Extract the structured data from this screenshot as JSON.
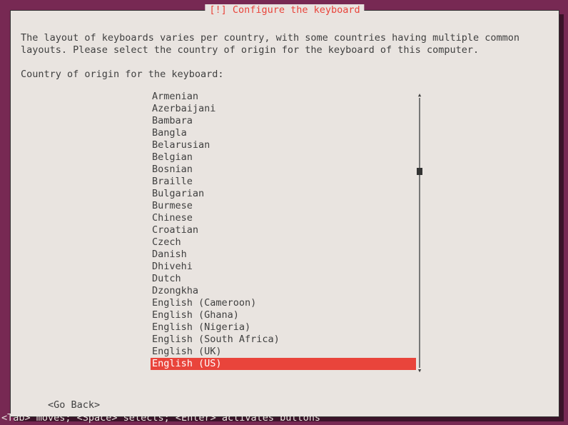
{
  "title": "[!] Configure the keyboard",
  "message": "The layout of keyboards varies per country, with some countries having multiple common layouts. Please select the country of origin for the keyboard of this computer.",
  "prompt": "Country of origin for the keyboard:",
  "items": [
    "Armenian",
    "Azerbaijani",
    "Bambara",
    "Bangla",
    "Belarusian",
    "Belgian",
    "Bosnian",
    "Braille",
    "Bulgarian",
    "Burmese",
    "Chinese",
    "Croatian",
    "Czech",
    "Danish",
    "Dhivehi",
    "Dutch",
    "Dzongkha",
    "English (Cameroon)",
    "English (Ghana)",
    "English (Nigeria)",
    "English (South Africa)",
    "English (UK)",
    "English (US)"
  ],
  "selected_index": 22,
  "go_back_label": "<Go Back>",
  "help_text": "<Tab> moves; <Space> selects; <Enter> activates buttons",
  "scroll": {
    "up_arrow": "▴",
    "down_arrow": "▾"
  }
}
